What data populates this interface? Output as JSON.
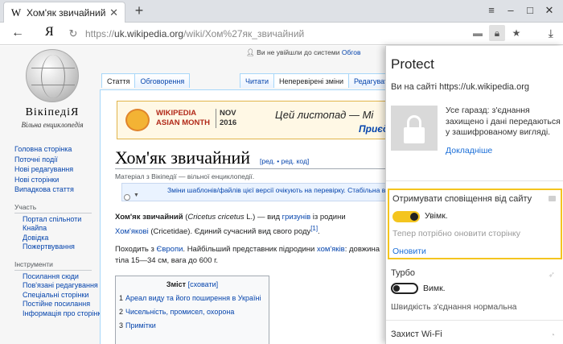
{
  "browser": {
    "tab_title": "Хом'як звичайний — Вікі",
    "tab_favicon": "W",
    "tab_close": "✕",
    "new_tab": "+",
    "yandex_logo": "Я",
    "url_prefix": "https://",
    "url_main": "uk.wikipedia.org",
    "url_rest": "/wiki/Хом%27як_звичайний",
    "icons": [
      "menu-icon",
      "minimize-icon",
      "maximize-icon",
      "close-icon",
      "back-icon",
      "reload-icon",
      "message-icon",
      "lock-icon",
      "star-icon",
      "download-icon"
    ]
  },
  "wiki": {
    "wordmark": "ВікіпедіЯ",
    "tagline": "Вільна енциклопедія",
    "personal_text": "Ви не увійшли до системи",
    "personal_link": "Обгов",
    "sidebar_main": [
      "Головна сторінка",
      "Поточні події",
      "Нові редагування",
      "Нові сторінки",
      "Випадкова стаття"
    ],
    "participation_heading": "Участь",
    "participation_links": [
      "Портал спільноти",
      "Кнайпа",
      "Довідка",
      "Пожертвування"
    ],
    "tools_heading": "Інструменти",
    "tools_links": [
      "Посилання сюди",
      "Пов'язані редагування",
      "Спеціальні сторінки",
      "Постійне посилання",
      "Інформація про сторінку"
    ],
    "tabs_left": [
      "Стаття",
      "Обговорення"
    ],
    "tabs_right": [
      "Читати",
      "Неперевірені зміни",
      "Редагувати"
    ],
    "banner": {
      "title_line1": "WIKIPEDIA",
      "title_line2": "ASIAN MONTH",
      "date_line1": "NOV",
      "date_line2": "2016",
      "text": "Цей листопад — Мі",
      "link": "Приєдн"
    },
    "article_title": "Хом'як звичайний",
    "edit_links": "[ред. • ред. код]",
    "subtitle": "Матеріал з Вікіпедії — вільної енциклопедії.",
    "flagged": "Зміни шаблонів/файлів цієї версії очікують на перевірку. Стабільна версія",
    "para1": {
      "bold": "Хом'як звичайний",
      "t1": " (",
      "latin": "Cricetus cricetus",
      "t2": " L.) — вид ",
      "link1": "гризунів",
      "t3": " із родини",
      "link2": "Хом'якові",
      "t4": " (Cricetidae). Єдиний сучасний вид свого роду",
      "ref": "[1]",
      "t5": "."
    },
    "para2": {
      "t1": "Походить з ",
      "link1": "Європи",
      "t2": ". Найбільший представник підродини ",
      "link2": "хом'яків",
      "t3": ": довжина",
      "line2": "тіла 15—34 см, вага до 600 г."
    },
    "toc": {
      "title": "Зміст",
      "toggle": "[сховати]",
      "items": [
        {
          "num": "1",
          "label": "Ареал виду та його поширення в Україні"
        },
        {
          "num": "2",
          "label": "Чисельність, промисел, охорона"
        },
        {
          "num": "3",
          "label": "Примітки"
        }
      ]
    }
  },
  "protect": {
    "title": "Protect",
    "site_text": "Ви на сайті https://uk.wikipedia.org",
    "secure_text": "Усе гаразд: з'єднання захищено і  дані передаються у зашифрованому вигляді.",
    "details_link": "Докладніше",
    "notifications_label": "Отримувати сповіщення від сайту",
    "notifications_state": "Увімк.",
    "notifications_on": true,
    "refresh_hint": "Тепер потрібно оновити сторінку",
    "refresh_link": "Оновити",
    "turbo_label": "Турбо",
    "turbo_state": "Вимк.",
    "turbo_on": false,
    "turbo_speed": "Швидкість з'єднання нормальна",
    "wifi_label": "Захист Wi-Fi",
    "accent_color": "#f4c51f",
    "link_color": "#1a6ed8"
  }
}
